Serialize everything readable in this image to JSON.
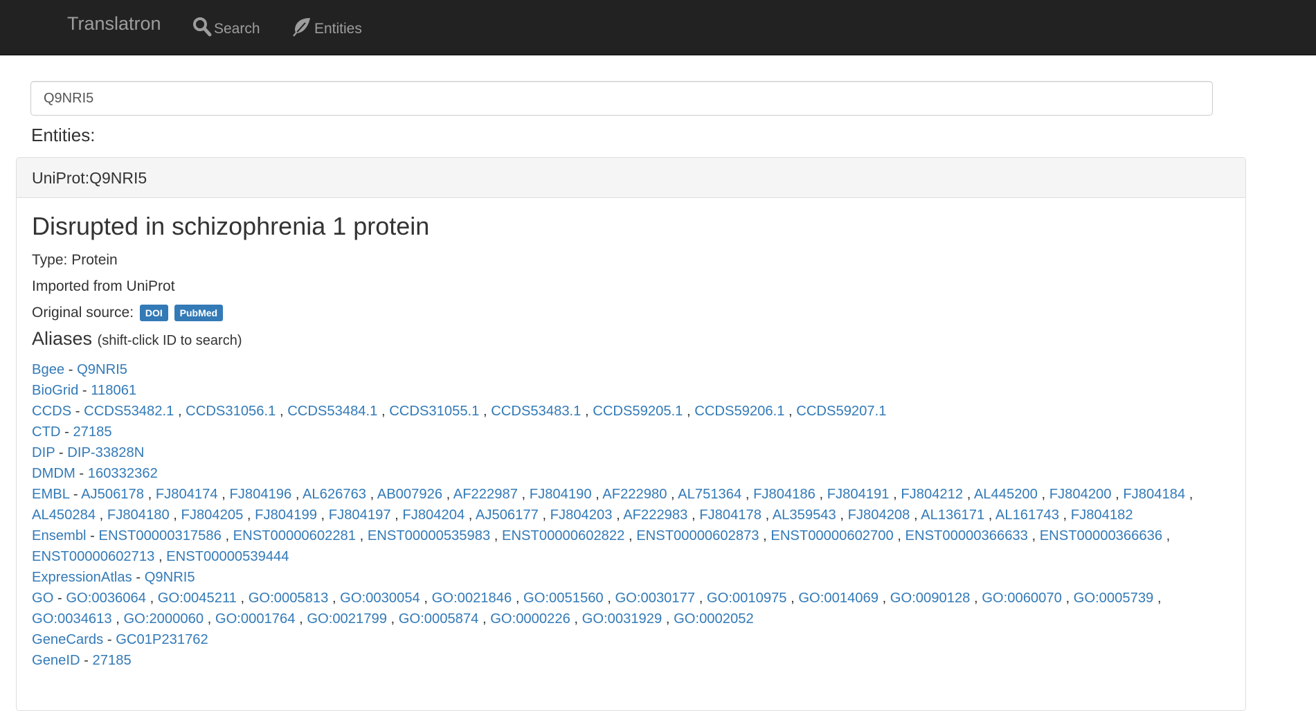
{
  "navbar": {
    "brand": "Translatron",
    "search_label": "Search",
    "entities_label": "Entities"
  },
  "search": {
    "value": "Q9NRI5"
  },
  "entities_heading": "Entities:",
  "entity": {
    "id_header": "UniProt:Q9NRI5",
    "title": "Disrupted in schizophrenia 1 protein",
    "type_line": "Type: Protein",
    "imported_line": "Imported from UniProt",
    "original_source_label": "Original source:",
    "badges": [
      "DOI",
      "PubMed"
    ],
    "aliases_heading": "Aliases",
    "aliases_hint": "(shift-click ID to search)",
    "aliases": [
      {
        "db": "Bgee",
        "ids": [
          "Q9NRI5"
        ]
      },
      {
        "db": "BioGrid",
        "ids": [
          "118061"
        ]
      },
      {
        "db": "CCDS",
        "ids": [
          "CCDS53482.1",
          "CCDS31056.1",
          "CCDS53484.1",
          "CCDS31055.1",
          "CCDS53483.1",
          "CCDS59205.1",
          "CCDS59206.1",
          "CCDS59207.1"
        ]
      },
      {
        "db": "CTD",
        "ids": [
          "27185"
        ]
      },
      {
        "db": "DIP",
        "ids": [
          "DIP-33828N"
        ]
      },
      {
        "db": "DMDM",
        "ids": [
          "160332362"
        ]
      },
      {
        "db": "EMBL",
        "ids": [
          "AJ506178",
          "FJ804174",
          "FJ804196",
          "AL626763",
          "AB007926",
          "AF222987",
          "FJ804190",
          "AF222980",
          "AL751364",
          "FJ804186",
          "FJ804191",
          "FJ804212",
          "AL445200",
          "FJ804200",
          "FJ804184",
          "AL450284",
          "FJ804180",
          "FJ804205",
          "FJ804199",
          "FJ804197",
          "FJ804204",
          "AJ506177",
          "FJ804203",
          "AF222983",
          "FJ804178",
          "AL359543",
          "FJ804208",
          "AL136171",
          "AL161743",
          "FJ804182"
        ]
      },
      {
        "db": "Ensembl",
        "ids": [
          "ENST00000317586",
          "ENST00000602281",
          "ENST00000535983",
          "ENST00000602822",
          "ENST00000602873",
          "ENST00000602700",
          "ENST00000366633",
          "ENST00000366636",
          "ENST00000602713",
          "ENST00000539444"
        ]
      },
      {
        "db": "ExpressionAtlas",
        "ids": [
          "Q9NRI5"
        ]
      },
      {
        "db": "GO",
        "ids": [
          "GO:0036064",
          "GO:0045211",
          "GO:0005813",
          "GO:0030054",
          "GO:0021846",
          "GO:0051560",
          "GO:0030177",
          "GO:0010975",
          "GO:0014069",
          "GO:0090128",
          "GO:0060070",
          "GO:0005739",
          "GO:0034613",
          "GO:2000060",
          "GO:0001764",
          "GO:0021799",
          "GO:0005874",
          "GO:0000226",
          "GO:0031929",
          "GO:0002052"
        ]
      },
      {
        "db": "GeneCards",
        "ids": [
          "GC01P231762"
        ]
      },
      {
        "db": "GeneID",
        "ids": [
          "27185"
        ]
      }
    ]
  },
  "colors": {
    "navbar_bg": "#222222",
    "link": "#337ab7",
    "badge": "#337ab7"
  }
}
